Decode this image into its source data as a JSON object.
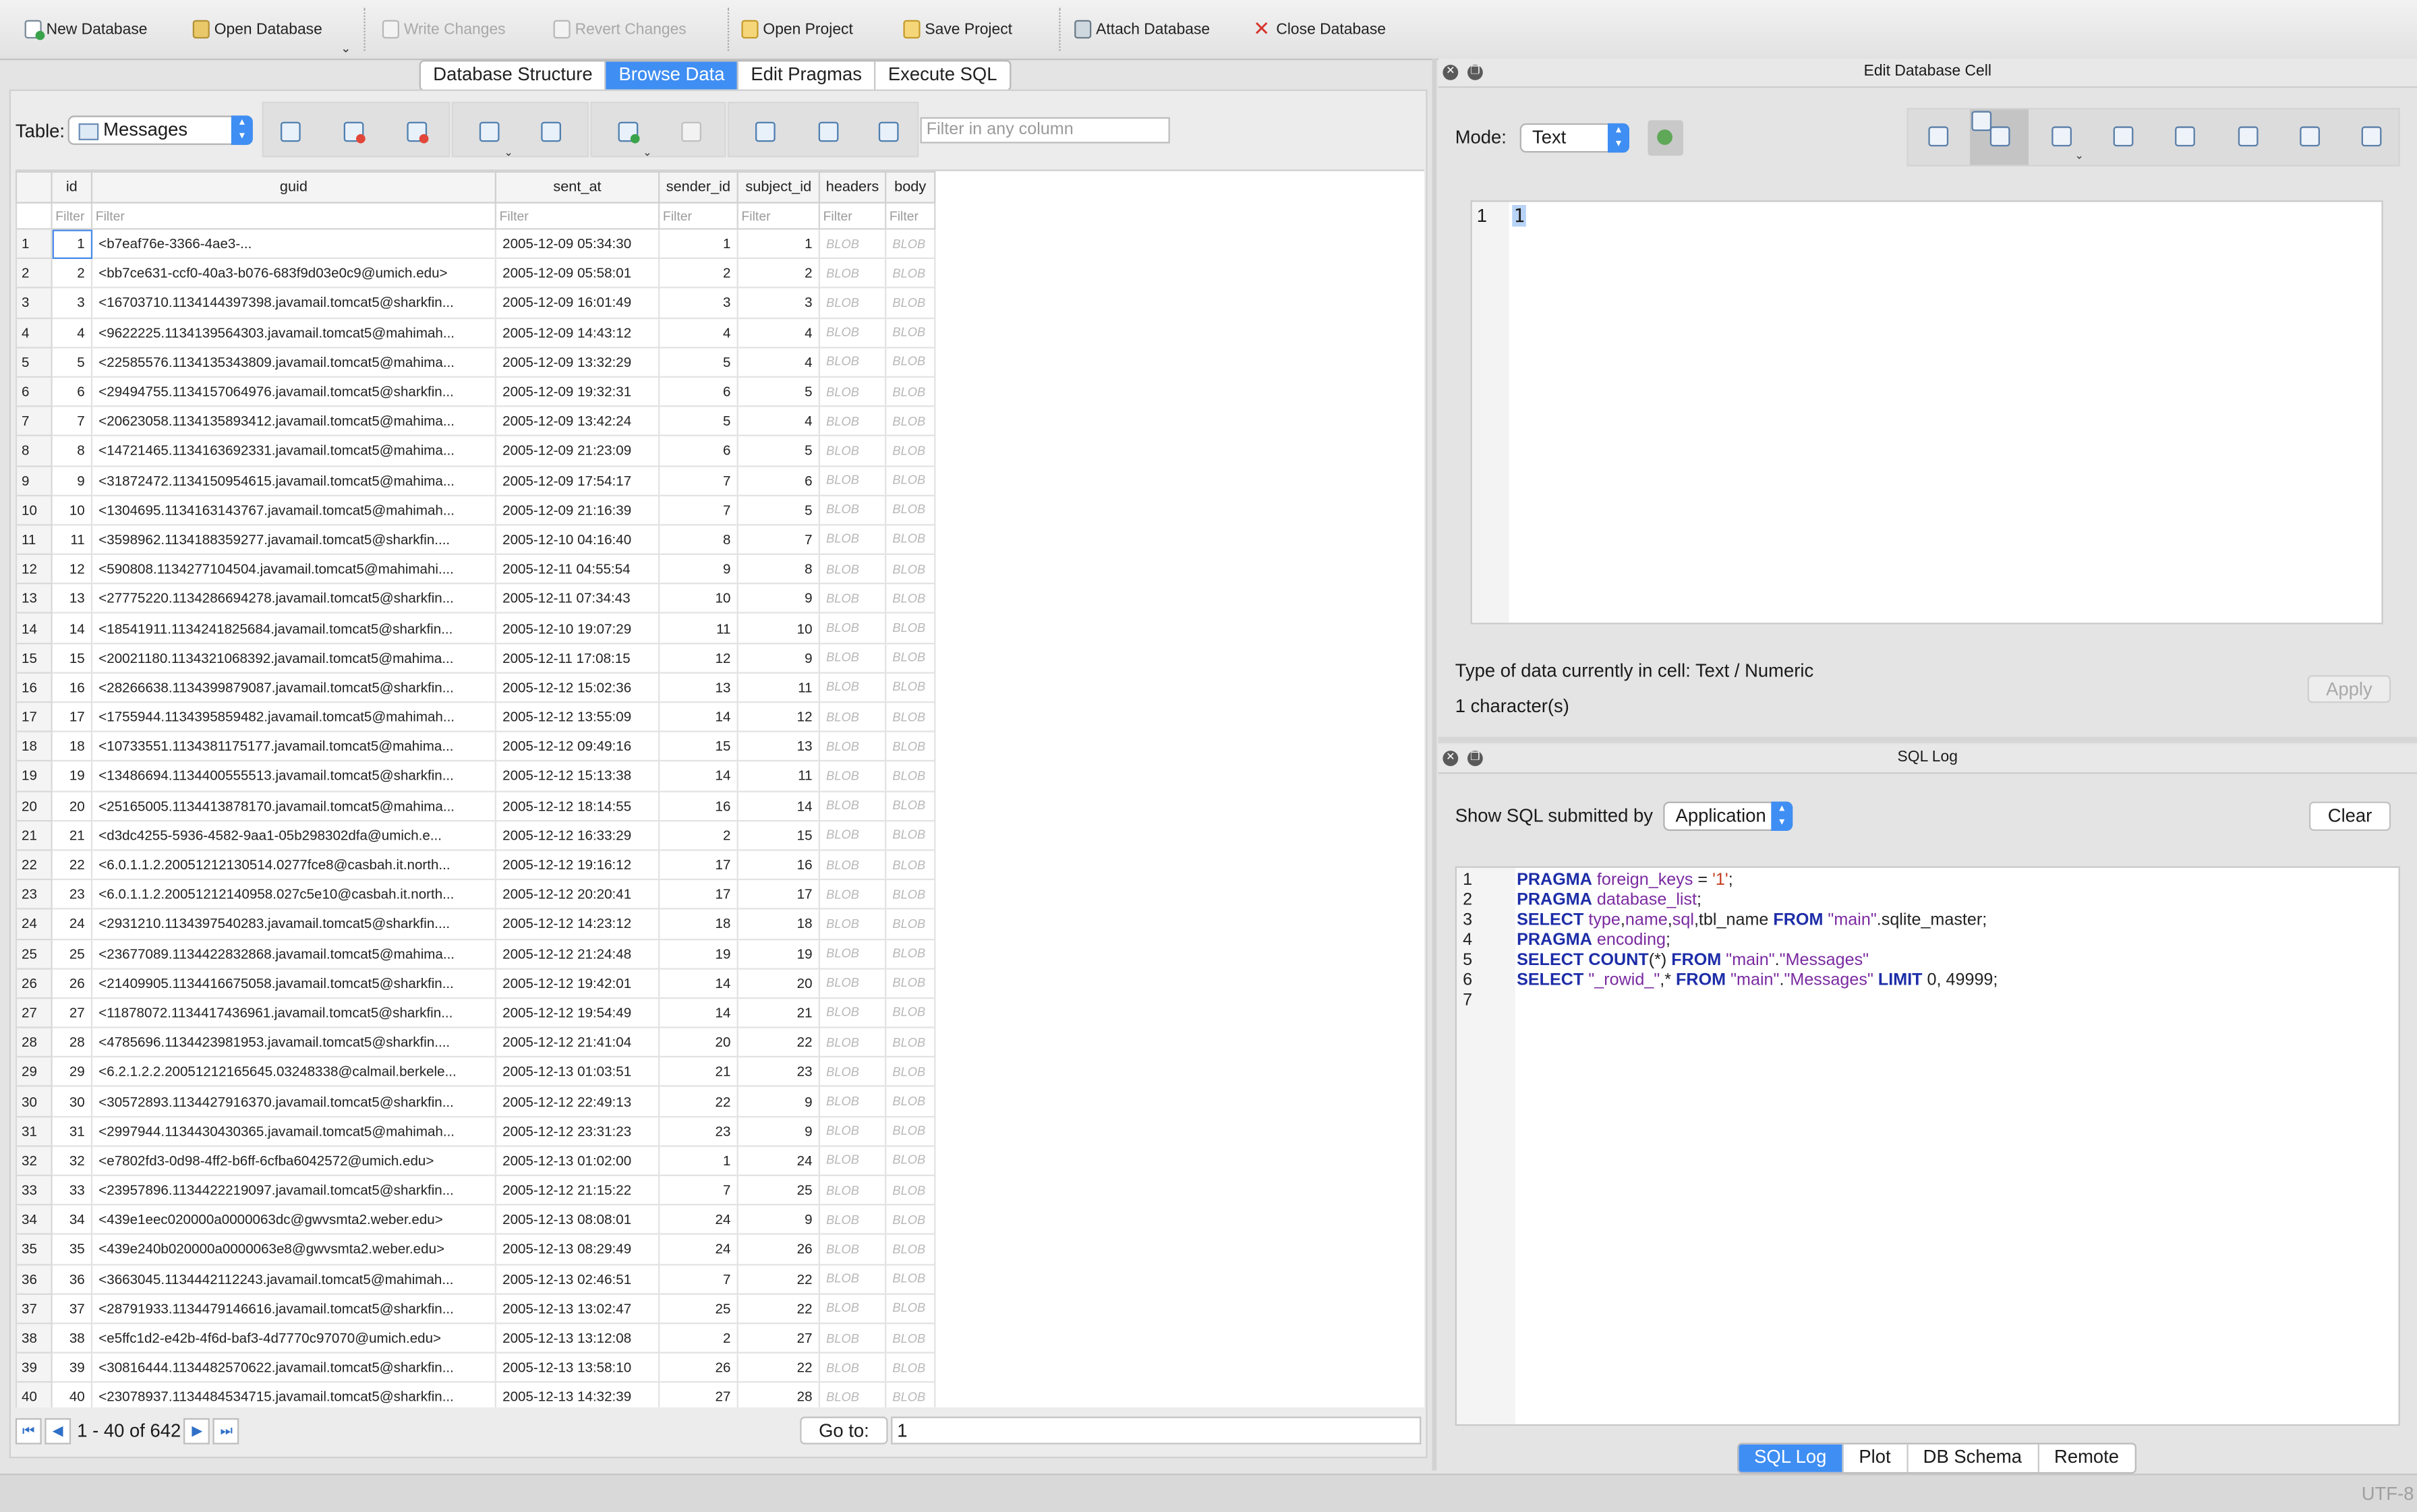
{
  "toolbar": {
    "new_database": "New Database",
    "open_database": "Open Database",
    "write_changes": "Write Changes",
    "revert_changes": "Revert Changes",
    "open_project": "Open Project",
    "save_project": "Save Project",
    "attach_database": "Attach Database",
    "close_database": "Close Database"
  },
  "tabs": [
    "Database Structure",
    "Browse Data",
    "Edit Pragmas",
    "Execute SQL"
  ],
  "browse": {
    "table_label": "Table:",
    "table_name": "Messages",
    "filter_any_placeholder": "Filter in any column",
    "filter_placeholder": "Filter",
    "columns": [
      "id",
      "guid",
      "sent_at",
      "sender_id",
      "subject_id",
      "headers",
      "body"
    ],
    "blob_label": "BLOB",
    "rows": [
      [
        1,
        "<b7eaf76e-3366-4ae3-...",
        "2005-12-09 05:34:30",
        1,
        1
      ],
      [
        2,
        "<bb7ce631-ccf0-40a3-b076-683f9d03e0c9@umich.edu>",
        "2005-12-09 05:58:01",
        2,
        2
      ],
      [
        3,
        "<16703710.1134144397398.javamail.tomcat5@sharkfin...",
        "2005-12-09 16:01:49",
        3,
        3
      ],
      [
        4,
        "<9622225.1134139564303.javamail.tomcat5@mahimah...",
        "2005-12-09 14:43:12",
        4,
        4
      ],
      [
        5,
        "<22585576.1134135343809.javamail.tomcat5@mahima...",
        "2005-12-09 13:32:29",
        5,
        4
      ],
      [
        6,
        "<29494755.1134157064976.javamail.tomcat5@sharkfin...",
        "2005-12-09 19:32:31",
        6,
        5
      ],
      [
        7,
        "<20623058.1134135893412.javamail.tomcat5@mahima...",
        "2005-12-09 13:42:24",
        5,
        4
      ],
      [
        8,
        "<14721465.1134163692331.javamail.tomcat5@mahima...",
        "2005-12-09 21:23:09",
        6,
        5
      ],
      [
        9,
        "<31872472.1134150954615.javamail.tomcat5@mahima...",
        "2005-12-09 17:54:17",
        7,
        6
      ],
      [
        10,
        "<1304695.1134163143767.javamail.tomcat5@mahimah...",
        "2005-12-09 21:16:39",
        7,
        5
      ],
      [
        11,
        "<3598962.1134188359277.javamail.tomcat5@sharkfin....",
        "2005-12-10 04:16:40",
        8,
        7
      ],
      [
        12,
        "<590808.1134277104504.javamail.tomcat5@mahimahi....",
        "2005-12-11 04:55:54",
        9,
        8
      ],
      [
        13,
        "<27775220.1134286694278.javamail.tomcat5@sharkfin...",
        "2005-12-11 07:34:43",
        10,
        9
      ],
      [
        14,
        "<18541911.1134241825684.javamail.tomcat5@sharkfin...",
        "2005-12-10 19:07:29",
        11,
        10
      ],
      [
        15,
        "<20021180.1134321068392.javamail.tomcat5@mahima...",
        "2005-12-11 17:08:15",
        12,
        9
      ],
      [
        16,
        "<28266638.1134399879087.javamail.tomcat5@sharkfin...",
        "2005-12-12 15:02:36",
        13,
        11
      ],
      [
        17,
        "<1755944.1134395859482.javamail.tomcat5@mahimah...",
        "2005-12-12 13:55:09",
        14,
        12
      ],
      [
        18,
        "<10733551.1134381175177.javamail.tomcat5@mahima...",
        "2005-12-12 09:49:16",
        15,
        13
      ],
      [
        19,
        "<13486694.1134400555513.javamail.tomcat5@sharkfin...",
        "2005-12-12 15:13:38",
        14,
        11
      ],
      [
        20,
        "<25165005.1134413878170.javamail.tomcat5@mahima...",
        "2005-12-12 18:14:55",
        16,
        14
      ],
      [
        21,
        "<d3dc4255-5936-4582-9aa1-05b298302dfa@umich.e...",
        "2005-12-12 16:33:29",
        2,
        15
      ],
      [
        22,
        "<6.0.1.1.2.20051212130514.0277fce8@casbah.it.north...",
        "2005-12-12 19:16:12",
        17,
        16
      ],
      [
        23,
        "<6.0.1.1.2.20051212140958.027c5e10@casbah.it.north...",
        "2005-12-12 20:20:41",
        17,
        17
      ],
      [
        24,
        "<2931210.1134397540283.javamail.tomcat5@sharkfin....",
        "2005-12-12 14:23:12",
        18,
        18
      ],
      [
        25,
        "<23677089.1134422832868.javamail.tomcat5@mahima...",
        "2005-12-12 21:24:48",
        19,
        19
      ],
      [
        26,
        "<21409905.1134416675058.javamail.tomcat5@sharkfin...",
        "2005-12-12 19:42:01",
        14,
        20
      ],
      [
        27,
        "<11878072.1134417436961.javamail.tomcat5@sharkfin...",
        "2005-12-12 19:54:49",
        14,
        21
      ],
      [
        28,
        "<4785696.1134423981953.javamail.tomcat5@sharkfin....",
        "2005-12-12 21:41:04",
        20,
        22
      ],
      [
        29,
        "<6.2.1.2.2.20051212165645.03248338@calmail.berkele...",
        "2005-12-13 01:03:51",
        21,
        23
      ],
      [
        30,
        "<30572893.1134427916370.javamail.tomcat5@sharkfin...",
        "2005-12-12 22:49:13",
        22,
        9
      ],
      [
        31,
        "<2997944.1134430430365.javamail.tomcat5@mahimah...",
        "2005-12-12 23:31:23",
        23,
        9
      ],
      [
        32,
        "<e7802fd3-0d98-4ff2-b6ff-6cfba6042572@umich.edu>",
        "2005-12-13 01:02:00",
        1,
        24
      ],
      [
        33,
        "<23957896.1134422219097.javamail.tomcat5@sharkfin...",
        "2005-12-12 21:15:22",
        7,
        25
      ],
      [
        34,
        "<439e1eec020000a0000063dc@gwvsmta2.weber.edu>",
        "2005-12-13 08:08:01",
        24,
        9
      ],
      [
        35,
        "<439e240b020000a0000063e8@gwvsmta2.weber.edu>",
        "2005-12-13 08:29:49",
        24,
        26
      ],
      [
        36,
        "<3663045.1134442112243.javamail.tomcat5@mahimah...",
        "2005-12-13 02:46:51",
        7,
        22
      ],
      [
        37,
        "<28791933.1134479146616.javamail.tomcat5@sharkfin...",
        "2005-12-13 13:02:47",
        25,
        22
      ],
      [
        38,
        "<e5ffc1d2-e42b-4f6d-baf3-4d7770c97070@umich.edu>",
        "2005-12-13 13:12:08",
        2,
        27
      ],
      [
        39,
        "<30816444.1134482570622.javamail.tomcat5@sharkfin...",
        "2005-12-13 13:58:10",
        26,
        22
      ],
      [
        40,
        "<23078937.1134484534715.javamail.tomcat5@sharkfin...",
        "2005-12-13 14:32:39",
        27,
        28
      ]
    ],
    "pager_text": "1 - 40 of 642",
    "goto_label": "Go to:",
    "goto_value": "1"
  },
  "edit_cell": {
    "title": "Edit Database Cell",
    "mode_label": "Mode:",
    "mode_value": "Text",
    "line_number": "1",
    "content": "1",
    "type_text": "Type of data currently in cell: Text / Numeric",
    "chars_text": "1 character(s)",
    "apply": "Apply"
  },
  "sql_log": {
    "title": "SQL Log",
    "show_label": "Show SQL submitted by",
    "submitted_by": "Application",
    "clear": "Clear",
    "line_numbers": [
      "1",
      "2",
      "3",
      "4",
      "5",
      "6",
      "7"
    ]
  },
  "bottom_tabs": [
    "SQL Log",
    "Plot",
    "DB Schema",
    "Remote"
  ],
  "status": {
    "encoding": "UTF-8"
  },
  "colors": {
    "accent": "#3f8ef3",
    "keyword": "#1d2da8",
    "identifier": "#7a2aa0",
    "string": "#c43b1f"
  }
}
